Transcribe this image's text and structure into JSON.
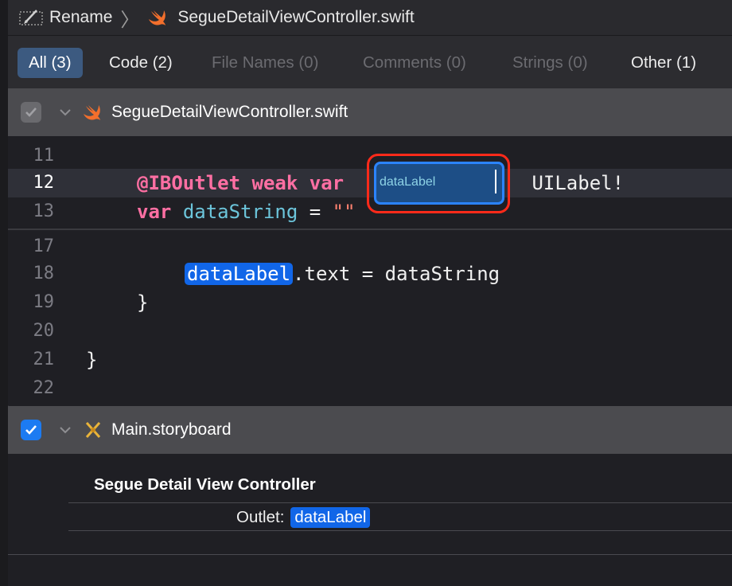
{
  "breadcrumb": {
    "action": "Rename",
    "file": "SegueDetailViewController.swift"
  },
  "filters": [
    {
      "label": "All (3)",
      "state": "active"
    },
    {
      "label": "Code (2)",
      "state": "normal"
    },
    {
      "label": "File Names (0)",
      "state": "disabled"
    },
    {
      "label": "Comments (0)",
      "state": "disabled"
    },
    {
      "label": "Strings (0)",
      "state": "disabled"
    },
    {
      "label": "Other (1)",
      "state": "normal"
    }
  ],
  "swift_file": {
    "name": "SegueDetailViewController.swift",
    "checked": true
  },
  "code": {
    "line_numbers": [
      "11",
      "12",
      "13",
      "17",
      "18",
      "19",
      "20",
      "21",
      "22"
    ],
    "outlet_attr": "@IBOutlet",
    "kw_weak": "weak",
    "kw_var": "var",
    "rename_field": "dataLabel",
    "outlet_type": " UILabel!",
    "datastring_ident": "dataString",
    "assign": " = ",
    "empty_string": "\"\"",
    "match_name": "dataLabel",
    "match_rest": ".text = dataString",
    "close_func": "}",
    "close_class": "}"
  },
  "storyboard_file": {
    "name": "Main.storyboard",
    "checked": true,
    "scene_title": "Segue Detail View Controller",
    "outlet_label": "Outlet:",
    "outlet_value": "dataLabel"
  },
  "colors": {
    "accent": "#1c7bf2",
    "keyword": "#ff6fa3",
    "identifier": "#6cc5db",
    "match_highlight": "#1166e8",
    "focus_ring": "#ff2a1a"
  }
}
